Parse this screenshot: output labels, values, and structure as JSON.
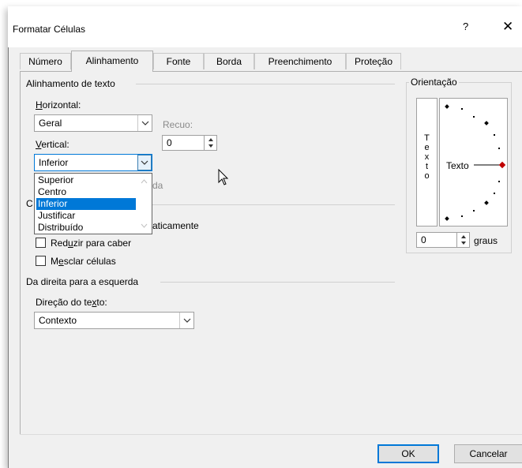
{
  "dialog": {
    "title": "Formatar Células",
    "help": "?",
    "close": "✕"
  },
  "tabs": [
    "Número",
    "Alinhamento",
    "Fonte",
    "Borda",
    "Preenchimento",
    "Proteção"
  ],
  "text_alignment": {
    "group_label": "Alinhamento de texto",
    "horizontal_label": "Horizontal:",
    "horizontal_value": "Geral",
    "indent_label": "Recuo:",
    "indent_value": "0",
    "vertical_label": "Vertical:",
    "vertical_value": "Inferior",
    "vertical_options": [
      "Superior",
      "Centro",
      "Inferior",
      "Justificar",
      "Distribuído"
    ],
    "vertical_selected": "Inferior",
    "distributed_partial": "da"
  },
  "text_control": {
    "group_partial": "C",
    "wrap_partial": "aticamente",
    "shrink_label": "Reduzir para caber",
    "merge_label": "Mesclar células"
  },
  "rtl": {
    "group_label": "Da direita para a esquerda",
    "direction_label": "Direção do texto:",
    "direction_value": "Contexto"
  },
  "orientation": {
    "group_label": "Orientação",
    "vertical_text": [
      "T",
      "e",
      "x",
      "t",
      "o"
    ],
    "dial_text": "Texto",
    "degrees_value": "0",
    "degrees_label": "graus"
  },
  "buttons": {
    "ok": "OK",
    "cancel": "Cancelar"
  },
  "colors": {
    "accent": "#0078d7",
    "dial_marker": "#c00000"
  }
}
